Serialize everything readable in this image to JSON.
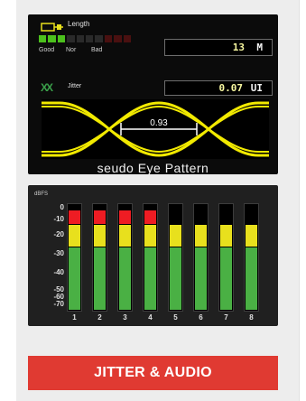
{
  "length": {
    "label": "Length",
    "value": "13",
    "unit": "M",
    "quality_labels": [
      "Good",
      "Nor",
      "Bad"
    ],
    "level_segments_lit": 3,
    "level_segments_total": 10
  },
  "jitter": {
    "label": "Jitter",
    "value": "0.07",
    "unit": "UI",
    "eye_opening": "0.93",
    "caption": "seudo Eye Pattern"
  },
  "meter": {
    "unit_label": "dBFS",
    "scale": [
      "0",
      "-10",
      "-20",
      "-30",
      "-40",
      "-50",
      "-60",
      "-70"
    ],
    "channels": [
      {
        "num": "1",
        "red": true
      },
      {
        "num": "2",
        "red": true
      },
      {
        "num": "3",
        "red": true
      },
      {
        "num": "4",
        "red": true
      },
      {
        "num": "5",
        "red": false
      },
      {
        "num": "6",
        "red": false
      },
      {
        "num": "7",
        "red": false
      },
      {
        "num": "8",
        "red": false
      }
    ]
  },
  "title": "JITTER & AUDIO",
  "colors": {
    "accent": "#e03a32",
    "meter_red": "#ee1c23",
    "meter_yellow": "#e8e01d",
    "meter_green": "#4ab044",
    "eye_yellow": "#f2ea00"
  }
}
